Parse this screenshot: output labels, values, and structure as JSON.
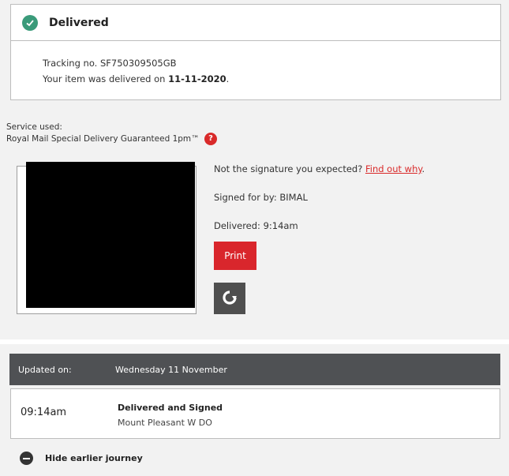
{
  "status": {
    "title": "Delivered",
    "tracking_label": "Tracking no. ",
    "tracking_number": "SF750309505GB",
    "delivered_prefix": "Your item was delivered on ",
    "delivered_date": "11-11-2020",
    "delivered_suffix": "."
  },
  "service": {
    "label": "Service used:",
    "name": "Royal Mail Special Delivery Guaranteed 1pm™",
    "help_glyph": "?"
  },
  "signature": {
    "question": "Not the signature you expected? ",
    "find_out_link": "Find out why",
    "question_suffix": ".",
    "signed_for": "Signed for by: BIMAL",
    "delivered_time": "Delivered: 9:14am",
    "print_label": "Print"
  },
  "updated": {
    "label": "Updated on:",
    "value": "Wednesday 11 November"
  },
  "event": {
    "time": "09:14am",
    "title": "Delivered and Signed",
    "location": "Mount Pleasant W DO"
  },
  "journey": {
    "toggle_label": "Hide earlier journey"
  },
  "colors": {
    "accent_red": "#d9262c",
    "success_green": "#3a9b7a",
    "dark_bar": "#4f5154"
  },
  "icons": {
    "status": "check-circle-icon",
    "help": "question-circle-icon",
    "rotate": "rotate-icon",
    "toggle": "minus-circle-icon"
  }
}
